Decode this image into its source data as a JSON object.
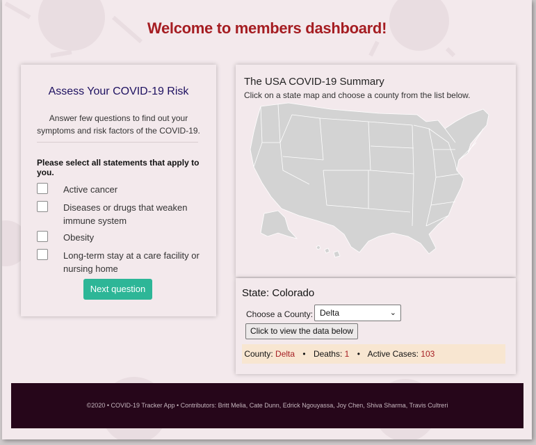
{
  "header": {
    "title": "Welcome to members dashboard!"
  },
  "risk_card": {
    "title": "Assess Your COVID-19 Risk",
    "intro_line1": "Answer few questions to find out your",
    "intro_line2": "symptoms and risk factors of the COVID-19.",
    "prompt": "Please select all statements that apply to you.",
    "options": [
      {
        "label": "Active cancer",
        "checked": false
      },
      {
        "label": "Diseases or drugs that weaken immune system",
        "checked": false
      },
      {
        "label": "Obesity",
        "checked": false
      },
      {
        "label": "Long-term stay at a care facility or nursing home",
        "checked": false
      }
    ],
    "next_label": "Next question"
  },
  "summary": {
    "title": "The USA COVID-19 Summary",
    "subtitle": "Click on a state map and choose a county from the list below."
  },
  "state_panel": {
    "state_label": "State: Colorado",
    "county_prompt": "Choose a County:",
    "county_selected": "Delta",
    "view_button": "Click to view the data below",
    "county_key": "County:",
    "county_value": "Delta",
    "deaths_key": "Deaths:",
    "deaths_value": "1",
    "active_key": "Active Cases:",
    "active_value": "103"
  },
  "footer": {
    "text": "©2020 • COVID-19 Tracker App • Contributors: Britt Melia, Cate Dunn, Edrick Ngouyassa, Joy Chen, Shiva Sharma, Travis Cultreri"
  },
  "colors": {
    "title_red": "#a51d22",
    "next_button_green": "#2db697",
    "footer_bg": "#26061a",
    "page_bg": "#f3e9ec"
  }
}
